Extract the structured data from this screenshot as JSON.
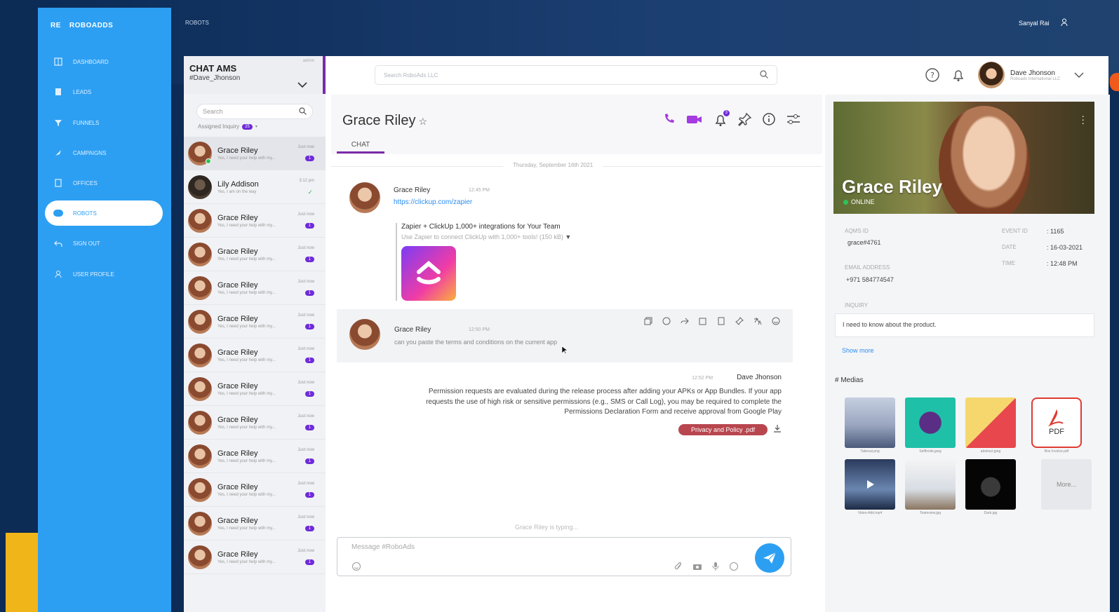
{
  "app": {
    "brand_short": "RE",
    "brand_name": "ROBOADDS",
    "breadcrumb": "ROBOTS"
  },
  "top_user": {
    "name": "Sanyal Rai"
  },
  "nav": [
    {
      "label": "DASHBOARD",
      "icon": "grid-icon"
    },
    {
      "label": "LEADS",
      "icon": "document-icon"
    },
    {
      "label": "FUNNELS",
      "icon": "funnel-icon"
    },
    {
      "label": "CAMPAIGNS",
      "icon": "rocket-icon"
    },
    {
      "label": "OFFICES",
      "icon": "tablet-icon"
    },
    {
      "label": "ROBOTS",
      "icon": "robot-icon"
    },
    {
      "label": "SIGN OUT",
      "icon": "undo-icon"
    },
    {
      "label": "USER PROFILE",
      "icon": "user-icon"
    }
  ],
  "chat_list": {
    "title": "CHAT AMS",
    "subtitle": "#Dave_Jhonson",
    "tiny": "admin",
    "search_placeholder": "Search",
    "assigned_label": "Assigned Inquiry",
    "assigned_count": "25",
    "items": [
      {
        "name": "Grace Riley",
        "preview": "Yes, I need your help with my...",
        "time": "Just now",
        "badge": "1",
        "online": true,
        "selected": true
      },
      {
        "name": "Lily Addison",
        "preview": "Yes, I am on the way",
        "time": "3:12 pm",
        "badge": "",
        "check": "✓"
      },
      {
        "name": "Grace Riley",
        "preview": "Yes, I need your help with my...",
        "time": "Just now",
        "badge": "1"
      },
      {
        "name": "Grace Riley",
        "preview": "Yes, I need your help with my...",
        "time": "Just now",
        "badge": "1"
      },
      {
        "name": "Grace Riley",
        "preview": "Yes, I need your help with my...",
        "time": "Just now",
        "badge": "1"
      },
      {
        "name": "Grace Riley",
        "preview": "Yes, I need your help with my...",
        "time": "Just now",
        "badge": "1"
      },
      {
        "name": "Grace Riley",
        "preview": "Yes, I need your help with my...",
        "time": "Just now",
        "badge": "1"
      },
      {
        "name": "Grace Riley",
        "preview": "Yes, I need your help with my...",
        "time": "Just now",
        "badge": "1"
      },
      {
        "name": "Grace Riley",
        "preview": "Yes, I need your help with my...",
        "time": "Just now",
        "badge": "1"
      },
      {
        "name": "Grace Riley",
        "preview": "Yes, I need your help with my...",
        "time": "Just now",
        "badge": "1"
      },
      {
        "name": "Grace Riley",
        "preview": "Yes, I need your help with my...",
        "time": "Just now",
        "badge": "1"
      },
      {
        "name": "Grace Riley",
        "preview": "Yes, I need your help with my...",
        "time": "Just now",
        "badge": "1"
      },
      {
        "name": "Grace Riley",
        "preview": "Yes, I need your help with my...",
        "time": "Just now",
        "badge": "1"
      }
    ]
  },
  "header": {
    "search_placeholder": "Search RoboAds LLC",
    "notif_count": "3",
    "user_name": "Dave Jhonson",
    "user_org": "Roboads International LLC"
  },
  "conversation": {
    "title": "Grace Riley",
    "tab": "CHAT",
    "date": "Thursday, September 16th 2021",
    "messages": [
      {
        "sender": "Grace Riley",
        "time": "12:45 PM",
        "link": "https://clickup.com/zapier",
        "card_title": "Zapier + ClickUp 1,000+ integrations for Your Team",
        "card_desc": "Use Zapier to connect ClickUp with 1,000+ tools! (150 kB)"
      },
      {
        "sender": "Grace Riley",
        "time": "12:50 PM",
        "text": "can you paste the terms and conditions on the current app"
      },
      {
        "sender": "Dave Jhonson",
        "time": "12:52 PM",
        "text": "Permission requests are evaluated during the release process after adding your APKs or App Bundles. If your app requests the use of high risk or sensitive permissions (e.g., SMS or Call Log), you may be required to complete the Permissions Declaration Form and receive approval from Google Play",
        "attachment": "Privacy and Policy .pdf"
      }
    ],
    "typing": "Grace Riley is typing...",
    "composer_placeholder": "Message #RoboAds"
  },
  "profile": {
    "name": "Grace Riley",
    "status": "ONLINE",
    "fields": {
      "ams_id_label": "AQMS ID",
      "ams_id": "grace#4761",
      "email_label": "EMAIL ADDRESS",
      "email": "+971 584774547",
      "event_label": "EVENT ID",
      "event": ": 1165",
      "date_label": "DATE",
      "date": ": 16-03-2021",
      "time_label": "TIME",
      "time": ": 12:48 PM",
      "inquiry_label": "INQUIRY",
      "inquiry": "I need to know about the product."
    },
    "show_more": "Show more",
    "medias_title": "Medias",
    "medias": [
      {
        "caption": "Takeout.png"
      },
      {
        "caption": "SelfInvite.jpeg"
      },
      {
        "caption": "abstract.jpeg"
      },
      {
        "caption": "Box Invoice.pdf"
      },
      {
        "caption": "Video-Add.mp4"
      },
      {
        "caption": "Teamview.jpg"
      },
      {
        "caption": "Dark.jpg"
      }
    ],
    "pdf_label": "PDF",
    "more_label": "More..."
  },
  "colors": {
    "sidebar": "#2d9ff2",
    "accent_purple": "#7a2aa8",
    "badge": "#6f2bd9",
    "link": "#2d8ef0",
    "attachment": "#b8464f"
  }
}
